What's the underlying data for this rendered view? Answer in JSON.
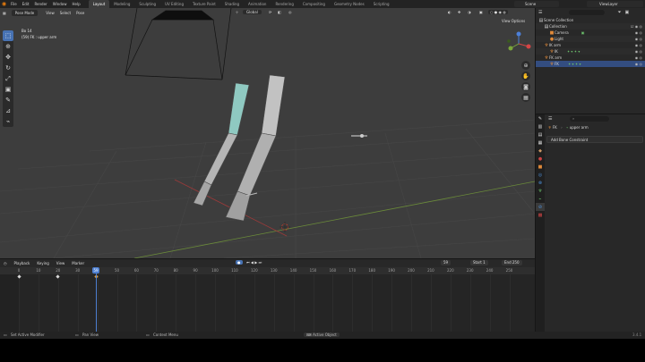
{
  "topbar": {
    "menu": [
      "File",
      "Edit",
      "Render",
      "Window",
      "Help"
    ],
    "workspaces": [
      "Layout",
      "Modeling",
      "Sculpting",
      "UV Editing",
      "Texture Paint",
      "Shading",
      "Animation",
      "Rendering",
      "Compositing",
      "Geometry Nodes",
      "Scripting"
    ],
    "active_workspace": "Layout",
    "scene": "Scene",
    "view_layer": "ViewLayer"
  },
  "viewport": {
    "mode": "Pose Mode",
    "menus": [
      "View",
      "Select",
      "Pose"
    ],
    "transform_orientation": "Global",
    "view_options": "View Options",
    "overlay_line1": "Bo 14",
    "overlay_line2": "(59) FK : upper arm"
  },
  "outliner": {
    "rows": [
      {
        "label": "Scene Collection",
        "icon": "collection-icon",
        "indent": 0
      },
      {
        "label": "Collection",
        "icon": "collection-icon",
        "indent": 1
      },
      {
        "label": "Camera",
        "icon": "camera-icon",
        "indent": 2
      },
      {
        "label": "Light",
        "icon": "light-icon",
        "indent": 2
      },
      {
        "label": "IK arm",
        "icon": "armature-icon",
        "indent": 1
      },
      {
        "label": "IK",
        "icon": "armature-icon",
        "indent": 2
      },
      {
        "label": "FK arm",
        "icon": "armature-icon",
        "indent": 1
      },
      {
        "label": "FK",
        "icon": "armature-icon",
        "indent": 2
      }
    ]
  },
  "properties": {
    "breadcrumb": [
      "FK",
      "upper arm"
    ],
    "add_button": "Add Bone Constraint"
  },
  "timeline": {
    "menus": [
      "Playback",
      "Keying",
      "View",
      "Marker"
    ],
    "current_frame": "59",
    "start_label": "Start",
    "start": "1",
    "end_label": "End",
    "end": "250",
    "ticks": [
      "0",
      "10",
      "20",
      "30",
      "40",
      "50",
      "60",
      "70",
      "80",
      "90",
      "100",
      "110",
      "120",
      "130",
      "140",
      "150",
      "160",
      "170",
      "180",
      "190",
      "200",
      "210",
      "220",
      "230",
      "240",
      "250"
    ],
    "playhead_label": "59"
  },
  "statusbar": {
    "items": [
      "Set Active Modifier",
      "Pan View",
      "Context Menu",
      "Active Object"
    ],
    "version": "3.4.1"
  },
  "colors": {
    "accent": "#4772b3",
    "selection_row": "#334d80",
    "keyframe_selected": "#e8a33c"
  }
}
